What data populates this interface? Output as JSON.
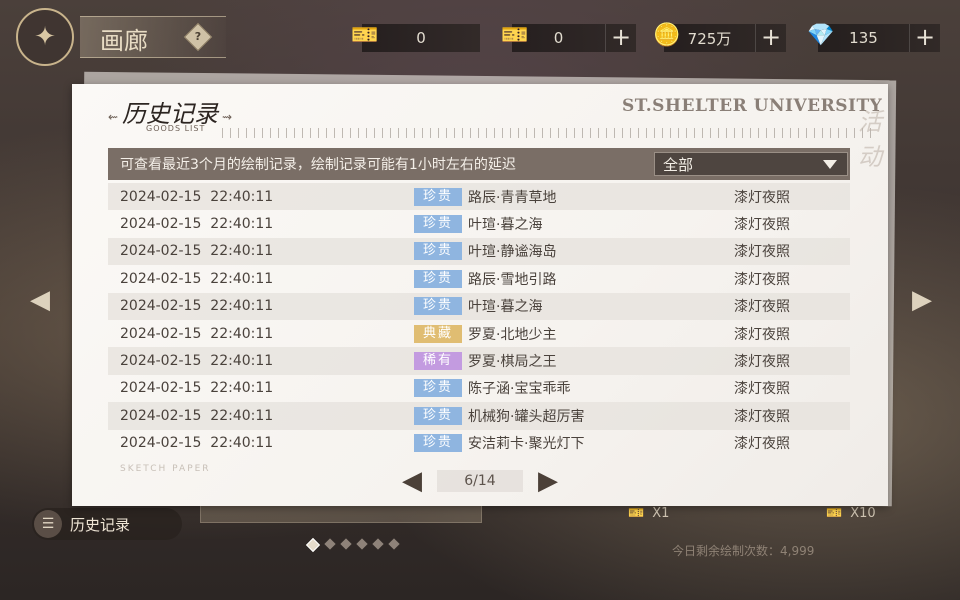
{
  "header": {
    "title": "画廊",
    "help": "?",
    "resources": [
      {
        "icon": "ticket-icon",
        "value": "0",
        "plus": false
      },
      {
        "icon": "ticket-icon",
        "value": "0",
        "plus": true
      },
      {
        "icon": "coin-icon",
        "value": "725万",
        "plus": true
      },
      {
        "icon": "gem-icon",
        "value": "135",
        "plus": true
      }
    ],
    "plus_label": "+"
  },
  "modal": {
    "title": "历史记录",
    "subtitle": "GOODS LIST",
    "brand": "ST.SHELTER UNIVERSITY",
    "watermark": "活动",
    "note": "可查看最近3个月的绘制记录，绘制记录可能有1小时左右的延迟",
    "filter_value": "全部",
    "sketch_label": "SKETCH PAPER",
    "page": "6/14",
    "records": [
      {
        "date": "2024-02-15",
        "time": "22:40:11",
        "rarity": "珍贵",
        "rarity_color": "#8fb5e0",
        "item": "路辰·青青草地",
        "source": "漆灯夜照"
      },
      {
        "date": "2024-02-15",
        "time": "22:40:11",
        "rarity": "珍贵",
        "rarity_color": "#8fb5e0",
        "item": "叶瑄·暮之海",
        "source": "漆灯夜照"
      },
      {
        "date": "2024-02-15",
        "time": "22:40:11",
        "rarity": "珍贵",
        "rarity_color": "#8fb5e0",
        "item": "叶瑄·静谧海岛",
        "source": "漆灯夜照"
      },
      {
        "date": "2024-02-15",
        "time": "22:40:11",
        "rarity": "珍贵",
        "rarity_color": "#8fb5e0",
        "item": "路辰·雪地引路",
        "source": "漆灯夜照"
      },
      {
        "date": "2024-02-15",
        "time": "22:40:11",
        "rarity": "珍贵",
        "rarity_color": "#8fb5e0",
        "item": "叶瑄·暮之海",
        "source": "漆灯夜照"
      },
      {
        "date": "2024-02-15",
        "time": "22:40:11",
        "rarity": "典藏",
        "rarity_color": "#e0bd72",
        "item": "罗夏·北地少主",
        "source": "漆灯夜照"
      },
      {
        "date": "2024-02-15",
        "time": "22:40:11",
        "rarity": "稀有",
        "rarity_color": "#c39be0",
        "item": "罗夏·棋局之王",
        "source": "漆灯夜照"
      },
      {
        "date": "2024-02-15",
        "time": "22:40:11",
        "rarity": "珍贵",
        "rarity_color": "#8fb5e0",
        "item": "陈子涵·宝宝乖乖",
        "source": "漆灯夜照"
      },
      {
        "date": "2024-02-15",
        "time": "22:40:11",
        "rarity": "珍贵",
        "rarity_color": "#8fb5e0",
        "item": "机械狗·罐头超厉害",
        "source": "漆灯夜照"
      },
      {
        "date": "2024-02-15",
        "time": "22:40:11",
        "rarity": "珍贵",
        "rarity_color": "#8fb5e0",
        "item": "安洁莉卡·聚光灯下",
        "source": "漆灯夜照"
      }
    ]
  },
  "footer": {
    "history_button": "历史记录",
    "draw_one": "X1",
    "draw_ten": "X10",
    "remaining": "今日剩余绘制次数：4,999"
  }
}
